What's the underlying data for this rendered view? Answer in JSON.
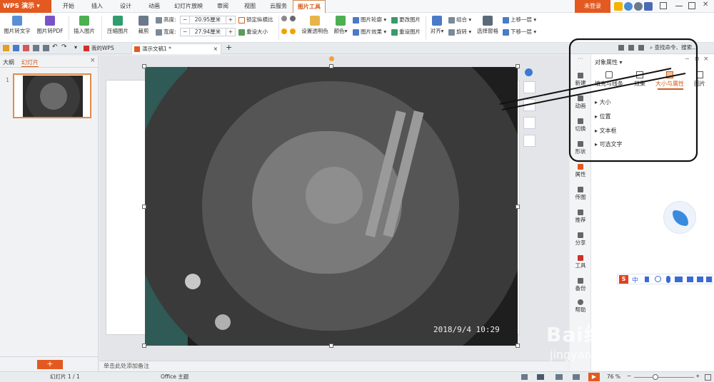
{
  "app": {
    "name": "WPS 演示",
    "login": "未登录"
  },
  "menu": [
    "开始",
    "插入",
    "设计",
    "动画",
    "幻灯片放映",
    "审阅",
    "视图",
    "云服务",
    "图片工具"
  ],
  "ribbon": {
    "pic_to_text": "图片转文字",
    "pic_to_pdf": "图片转PDF",
    "insert_pic": "插入图片",
    "compress_pic": "压缩图片",
    "crop": "裁剪",
    "height_label": "高度:",
    "height_value": "20.95厘米",
    "width_label": "宽度:",
    "width_value": "27.94厘米",
    "lock_ratio": "锁定纵横比",
    "reset_size": "重设大小",
    "set_transparent": "设置透明色",
    "color": "颜色",
    "pic_outline": "图片轮廓",
    "pic_effect": "图片效果",
    "change_pic": "更改图片",
    "reset_pic": "重设图片",
    "align": "对齐",
    "group": "组合",
    "rotate": "旋转",
    "select_pane": "选择窗格",
    "bring_forward": "上移一层",
    "send_backward": "下移一层"
  },
  "tabs": [
    {
      "label": "我的WPS"
    },
    {
      "label": "演示文稿1 *"
    }
  ],
  "search": {
    "placeholder": "查找命令、搜索..."
  },
  "left_panel": {
    "outline": "大纲",
    "slides": "幻灯片",
    "slide_number": "1"
  },
  "notes": "单击此处添加备注",
  "photo": {
    "timestamp": "2018/9/4  10:29"
  },
  "obj_panel": {
    "title": "对象属性",
    "tabs": [
      "填充与线条",
      "效果",
      "大小与属性",
      "图片"
    ],
    "sections": [
      "大小",
      "位置",
      "文本框",
      "可选文字"
    ]
  },
  "side_strip": [
    "新建",
    "动画",
    "切换",
    "形状",
    "属性",
    "传图",
    "推荐",
    "分享",
    "工具",
    "备份",
    "帮助"
  ],
  "ime_bar": {
    "mode": "中"
  },
  "status": {
    "slide_info": "幻灯片 1 / 1",
    "theme": "Office 主题",
    "zoom": "76 %"
  },
  "watermark": {
    "brand": "Bai经验",
    "url": "jingyan.baidu.com"
  },
  "colors": {
    "accent": "#e3591f",
    "active_tab": "#d05a1a",
    "highlight_box": "#111111"
  }
}
